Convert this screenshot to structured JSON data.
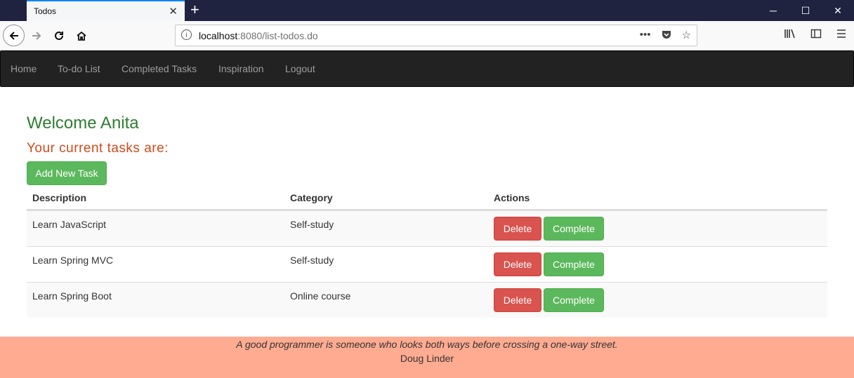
{
  "browser": {
    "tab_title": "Todos",
    "tab_close": "✕",
    "new_tab": "+",
    "url_host": "localhost",
    "url_rest": ":8080/list-todos.do",
    "win_min": "─",
    "win_max": "☐",
    "win_close": "✕"
  },
  "nav": {
    "items": [
      "Home",
      "To-do List",
      "Completed Tasks",
      "Inspiration",
      "Logout"
    ]
  },
  "content": {
    "welcome": "Welcome Anita",
    "subtitle": "Your current tasks are:",
    "add_button": "Add New Task",
    "headers": [
      "Description",
      "Category",
      "Actions"
    ],
    "rows": [
      {
        "description": "Learn JavaScript",
        "category": "Self-study"
      },
      {
        "description": "Learn Spring MVC",
        "category": "Self-study"
      },
      {
        "description": "Learn Spring Boot",
        "category": "Online course"
      }
    ],
    "delete_label": "Delete",
    "complete_label": "Complete"
  },
  "footer": {
    "quote": "A good programmer is someone who looks both ways before crossing a one-way street.",
    "author": "Doug Linder"
  },
  "colors": {
    "welcome": "#2e7d32",
    "subtitle": "#d04a1a",
    "success": "#5cb85c",
    "danger": "#d9534f",
    "footer_bg": "#ffab91",
    "navbar_bg": "#222222"
  }
}
